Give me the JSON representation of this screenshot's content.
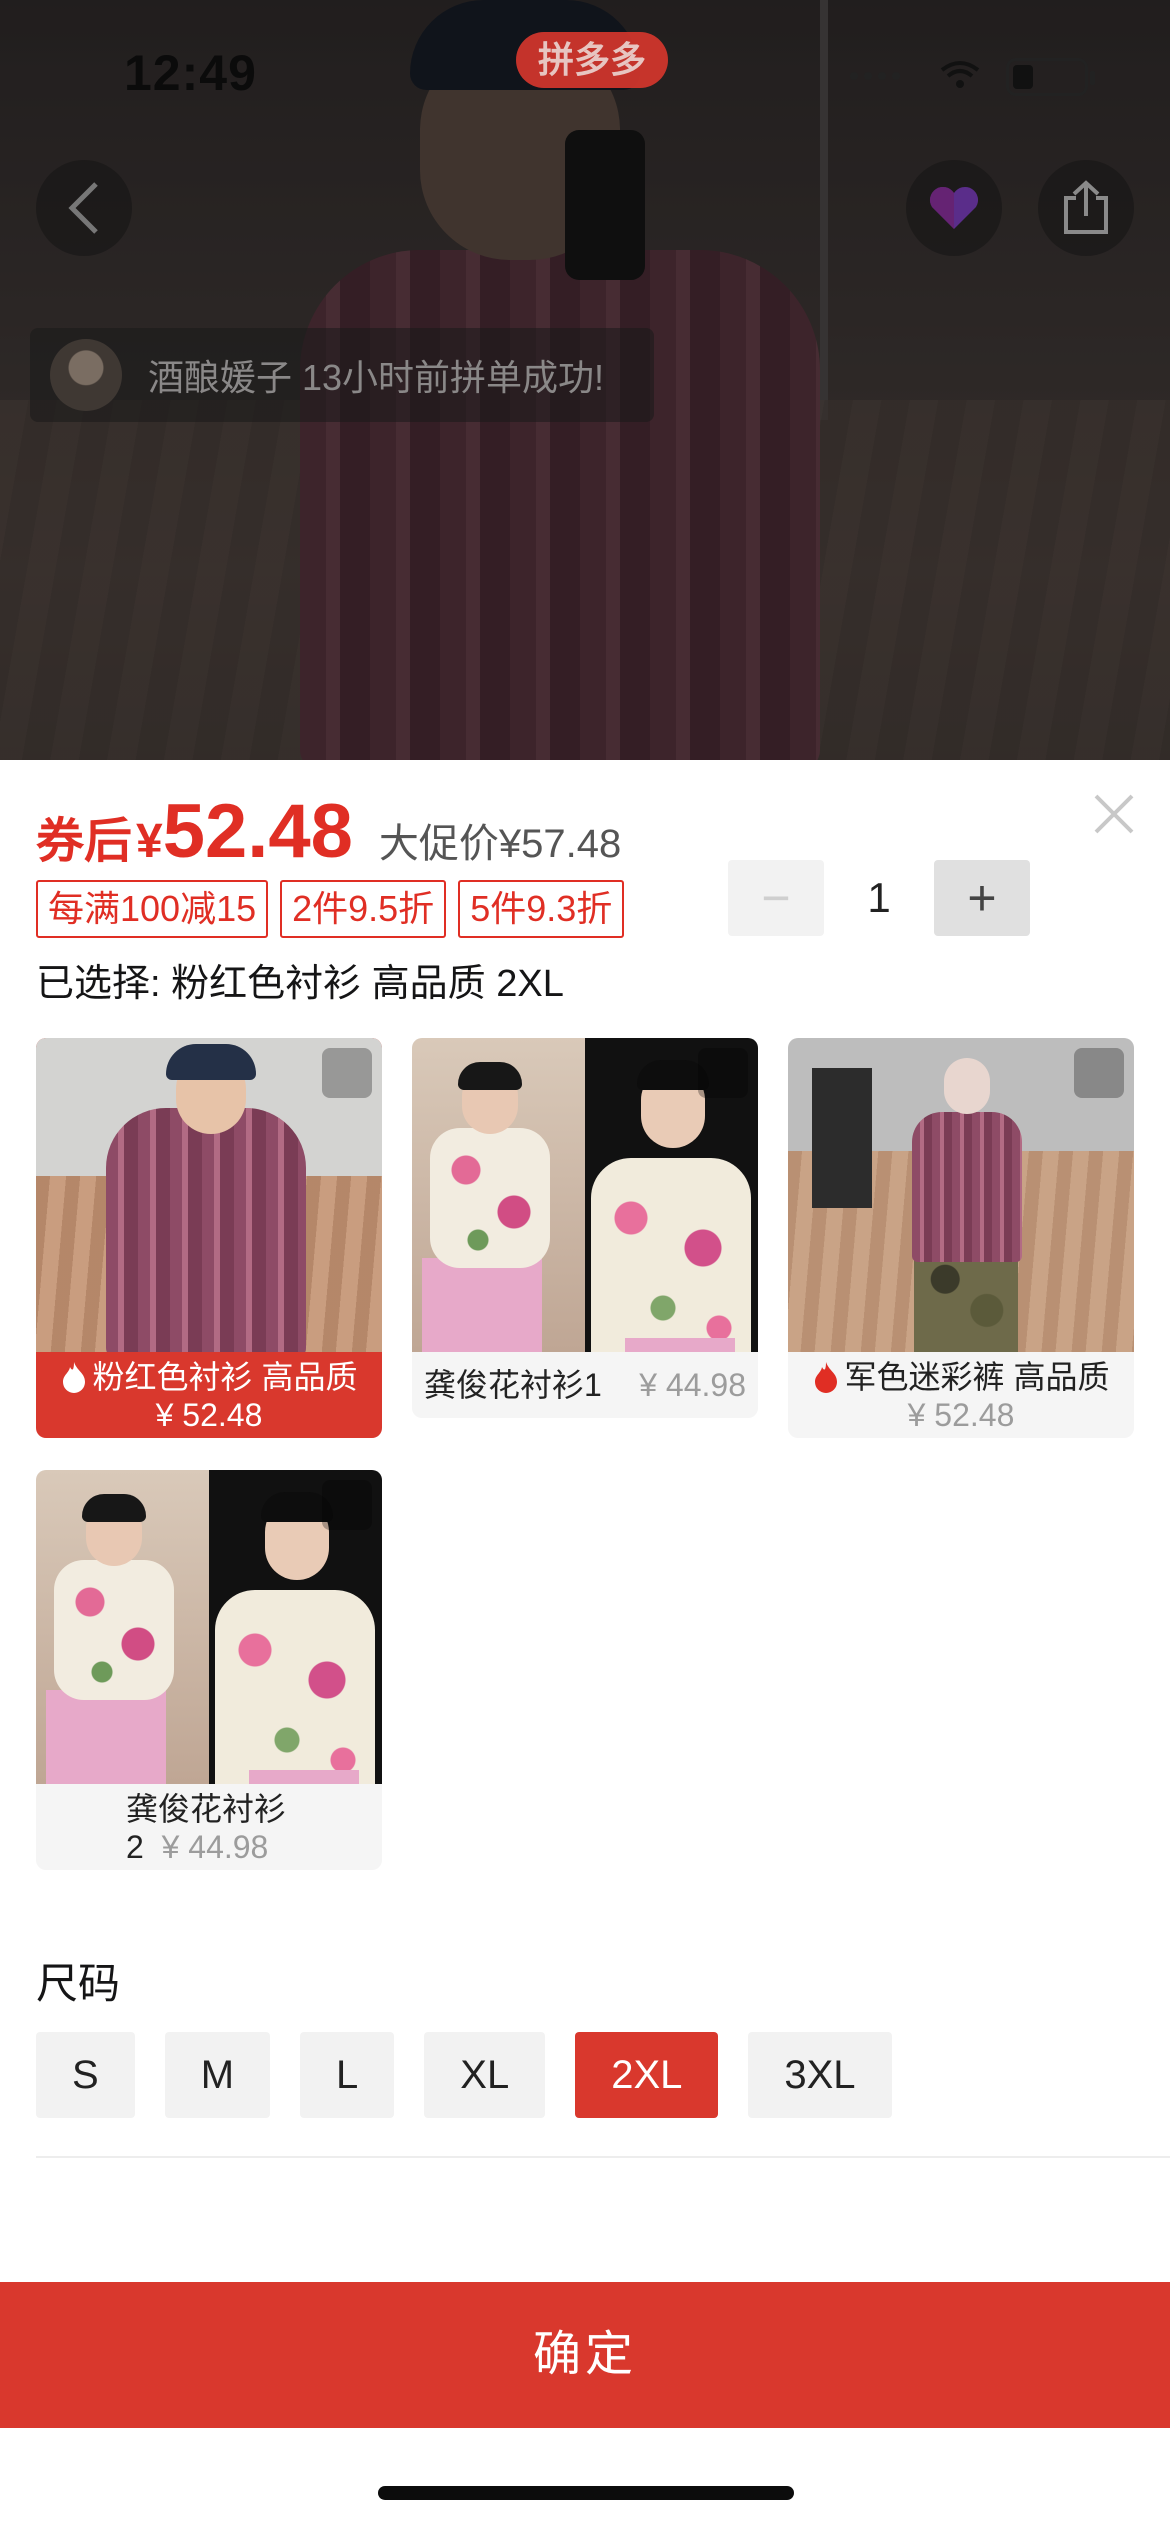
{
  "status_bar": {
    "time": "12:49",
    "badge": "拼多多"
  },
  "notice": {
    "text": "酒酿媛子 13小时前拼单成功!"
  },
  "price": {
    "coupon_label": "券后",
    "currency": "¥",
    "value": "52.48",
    "promo": "大促价¥57.48"
  },
  "tags": [
    "每满100减15",
    "2件9.5折",
    "5件9.3折"
  ],
  "quantity": {
    "minus": "−",
    "value": "1",
    "plus": "+"
  },
  "selected_text": "已选择: 粉红色衬衫 高品质 2XL",
  "options": [
    {
      "name": "粉红色衬衫 高品质",
      "price": "¥ 52.48",
      "selected": true
    },
    {
      "name": "龚俊花衬衫1",
      "price": "¥ 44.98",
      "selected": false
    },
    {
      "name": "军色迷彩裤 高品质",
      "price": "¥ 52.48",
      "selected": false
    },
    {
      "name_line1": "龚俊花衬衫",
      "name_line2": "2",
      "price": "¥ 44.98",
      "selected": false
    }
  ],
  "size": {
    "title": "尺码",
    "options": [
      "S",
      "M",
      "L",
      "XL",
      "2XL",
      "3XL"
    ],
    "selected": "2XL"
  },
  "confirm_label": "确定",
  "colors": {
    "brand_red": "#d9382d",
    "price_red": "#e02e24"
  }
}
